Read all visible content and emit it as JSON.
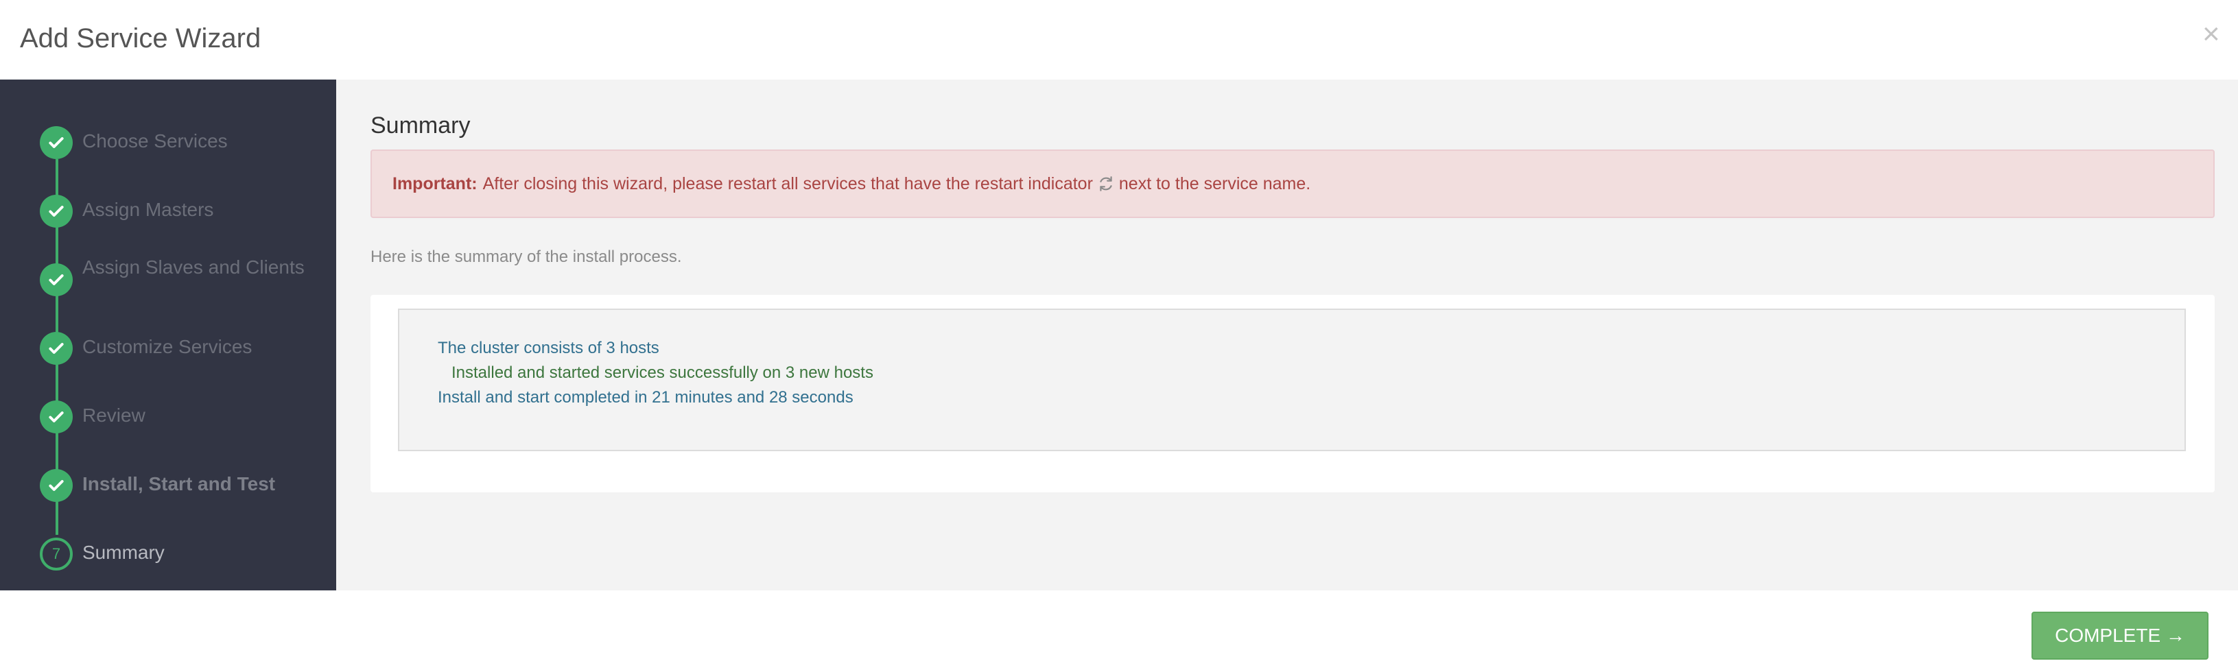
{
  "header": {
    "title": "Add Service Wizard",
    "close_label": "×"
  },
  "sidebar": {
    "steps": [
      {
        "label": "Choose Services",
        "state": "done"
      },
      {
        "label": "Assign Masters",
        "state": "done"
      },
      {
        "label": "Assign Slaves and Clients",
        "state": "done"
      },
      {
        "label": "Customize Services",
        "state": "done"
      },
      {
        "label": "Review",
        "state": "done"
      },
      {
        "label": "Install, Start and Test",
        "state": "done"
      },
      {
        "label": "Summary",
        "state": "current",
        "number": "7"
      }
    ]
  },
  "main": {
    "title": "Summary",
    "alert": {
      "strong": "Important:",
      "text_before": "After closing this wizard, please restart all services that have the restart indicator",
      "text_after": "next to the service name."
    },
    "intro": "Here is the summary of the install process.",
    "summary_lines": [
      "The cluster consists of 3 hosts",
      "Installed and started services successfully on 3 new hosts",
      "Install and start completed in 21 minutes and 28 seconds"
    ]
  },
  "footer": {
    "complete_label": "COMPLETE →"
  },
  "colors": {
    "accent": "#3fae6a",
    "sidebar_bg": "#323544",
    "alert_text": "#a94442",
    "alert_bg": "#f2dede",
    "button": "#6eb66e"
  }
}
